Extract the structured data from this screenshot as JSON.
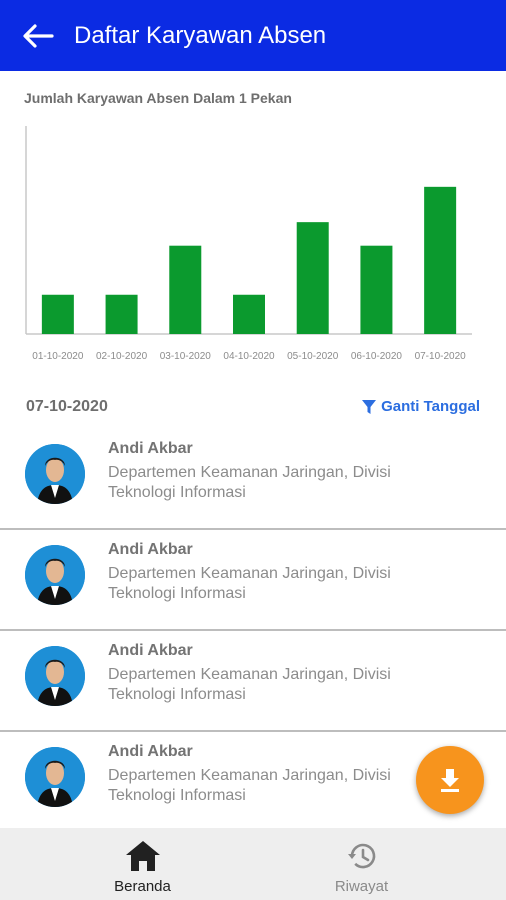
{
  "appbar": {
    "title": "Daftar Karyawan Absen"
  },
  "chart_section": {
    "title": "Jumlah Karyawan Absen Dalam 1 Pekan"
  },
  "chart_data": {
    "type": "bar",
    "categories": [
      "01-10-2020",
      "02-10-2020",
      "03-10-2020",
      "04-10-2020",
      "05-10-2020",
      "06-10-2020",
      "07-10-2020"
    ],
    "values": [
      1,
      1,
      2.25,
      1,
      2.85,
      2.25,
      3.75
    ],
    "title": "Jumlah Karyawan Absen Dalam 1 Pekan",
    "xlabel": "",
    "ylabel": "",
    "ylim": [
      0,
      5.3
    ],
    "grid": false,
    "color": "#0b9a2e"
  },
  "filter": {
    "selected_date": "07-10-2020",
    "change_label": "Ganti Tanggal"
  },
  "employees": [
    {
      "name": "Andi Akbar",
      "department": "Departemen Keamanan Jaringan, Divisi Teknologi Informasi"
    },
    {
      "name": "Andi Akbar",
      "department": "Departemen Keamanan Jaringan, Divisi Teknologi Informasi"
    },
    {
      "name": "Andi Akbar",
      "department": "Departemen Keamanan Jaringan, Divisi Teknologi Informasi"
    },
    {
      "name": "Andi Akbar",
      "department": "Departemen Keamanan Jaringan, Divisi Teknologi Informasi"
    }
  ],
  "bottom_nav": {
    "items": [
      {
        "label": "Beranda",
        "icon": "home-icon",
        "active": true
      },
      {
        "label": "Riwayat",
        "icon": "history-icon",
        "active": false
      }
    ]
  },
  "colors": {
    "appbar": "#0b2be3",
    "accent": "#2c6ee0",
    "fab": "#f7941d",
    "bar": "#0b9a2e"
  }
}
